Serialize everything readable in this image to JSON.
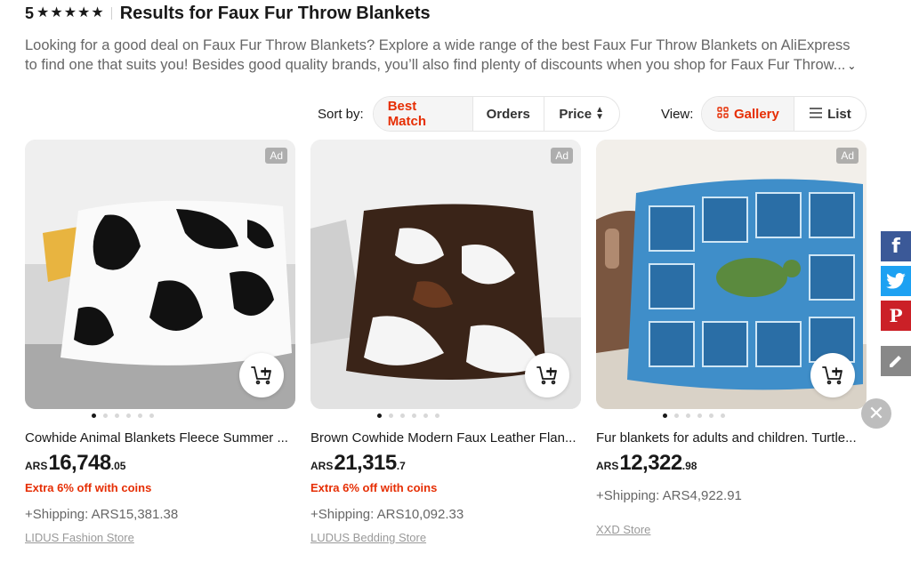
{
  "header": {
    "rating": "5",
    "stars": [
      "★",
      "★",
      "★",
      "★",
      "★"
    ],
    "title": "Results for Faux Fur Throw Blankets"
  },
  "description": {
    "line1": "Looking for a good deal on Faux Fur Throw Blankets? Explore a wide range of the best Faux Fur Throw Blankets on AliExpress",
    "line2": "to find one that suits you! Besides good quality brands, you’ll also find plenty of discounts when you shop for Faux Fur Throw...",
    "more_icon": "chevron-down-icon"
  },
  "sort": {
    "label": "Sort by:",
    "options": [
      "Best Match",
      "Orders",
      "Price"
    ],
    "active": "Best Match"
  },
  "view": {
    "label": "View:",
    "options": [
      "Gallery",
      "List"
    ],
    "active": "Gallery"
  },
  "colors": {
    "accent": "#e62e04",
    "facebook": "#3b5998",
    "twitter": "#1da1f2",
    "pinterest": "#cb2027"
  },
  "products": [
    {
      "ad": "Ad",
      "name": "Cowhide Animal Blankets Fleece Summer ...",
      "currency": "ARS",
      "price_int": "16,748",
      "price_dec": ".05",
      "promo": "Extra 6% off with coins",
      "shipping": "+Shipping: ARS15,381.38",
      "store": "LIDUS Fashion Store",
      "dots": 6,
      "active_dot": 0
    },
    {
      "ad": "Ad",
      "name": "Brown Cowhide Modern Faux Leather Flan...",
      "currency": "ARS",
      "price_int": "21,315",
      "price_dec": ".7",
      "promo": "Extra 6% off with coins",
      "shipping": "+Shipping: ARS10,092.33",
      "store": "LUDUS Bedding Store",
      "dots": 6,
      "active_dot": 0
    },
    {
      "ad": "Ad",
      "name": "Fur blankets for adults and children. Turtle...",
      "currency": "ARS",
      "price_int": "12,322",
      "price_dec": ".98",
      "promo": "",
      "shipping": "+Shipping: ARS4,922.91",
      "store": "XXD Store",
      "dots": 6,
      "active_dot": 0
    }
  ],
  "social": {
    "facebook": "f",
    "pinterest": "P",
    "close": "✕"
  }
}
